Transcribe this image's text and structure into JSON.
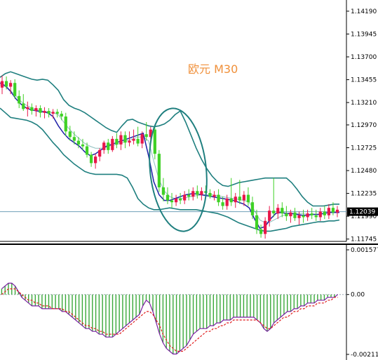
{
  "chart_data": [
    {
      "type": "candlestick",
      "title": "欧元 M30",
      "price_axis_ticks": [
        "1.14190",
        "1.13945",
        "1.13700",
        "1.13455",
        "1.13210",
        "1.12970",
        "1.12725",
        "1.12480",
        "1.12235",
        "1.11990",
        "1.11745"
      ],
      "current_price": "1.12039",
      "ylim": [
        1.1172,
        1.1431
      ],
      "indicators": [
        "Bollinger Bands (upper/middle/lower)",
        "Moving average (blue)",
        "Price path sketch (hand-drawn ellipse annotations)"
      ],
      "colors": {
        "up": "#e8174a",
        "down": "#3fd126",
        "bands": "#1f7f7f",
        "ma": "#1f20a8",
        "price_line": "#6f9fb8",
        "annotation": "#1f7f7f"
      },
      "candles": [
        [
          1.1337,
          1.135,
          1.133,
          1.1344
        ],
        [
          1.1344,
          1.1349,
          1.1335,
          1.1338
        ],
        [
          1.1338,
          1.1345,
          1.133,
          1.1342
        ],
        [
          1.1342,
          1.1346,
          1.1325,
          1.1328
        ],
        [
          1.1328,
          1.1334,
          1.1315,
          1.132
        ],
        [
          1.132,
          1.133,
          1.1312,
          1.1314
        ],
        [
          1.1314,
          1.1322,
          1.1306,
          1.1316
        ],
        [
          1.1316,
          1.132,
          1.1308,
          1.1312
        ],
        [
          1.1312,
          1.1318,
          1.1306,
          1.1315
        ],
        [
          1.1315,
          1.1318,
          1.1305,
          1.131
        ],
        [
          1.131,
          1.1316,
          1.1304,
          1.1312
        ],
        [
          1.1312,
          1.1315,
          1.1305,
          1.1309
        ],
        [
          1.1309,
          1.1314,
          1.1304,
          1.1311
        ],
        [
          1.1311,
          1.1314,
          1.1305,
          1.1309
        ],
        [
          1.1309,
          1.1312,
          1.1302,
          1.1306
        ],
        [
          1.1306,
          1.131,
          1.1285,
          1.129
        ],
        [
          1.129,
          1.1296,
          1.128,
          1.1284
        ],
        [
          1.1284,
          1.129,
          1.1276,
          1.128
        ],
        [
          1.128,
          1.1284,
          1.1272,
          1.1276
        ],
        [
          1.1276,
          1.1282,
          1.127,
          1.1274
        ],
        [
          1.1274,
          1.1278,
          1.1262,
          1.1265
        ],
        [
          1.1265,
          1.1268,
          1.1252,
          1.1256
        ],
        [
          1.1256,
          1.1266,
          1.125,
          1.1263
        ],
        [
          1.1263,
          1.1272,
          1.1258,
          1.127
        ],
        [
          1.127,
          1.128,
          1.1266,
          1.1278
        ],
        [
          1.1278,
          1.1282,
          1.1266,
          1.127
        ],
        [
          1.127,
          1.1285,
          1.1268,
          1.1282
        ],
        [
          1.1282,
          1.1288,
          1.1272,
          1.1276
        ],
        [
          1.1276,
          1.129,
          1.127,
          1.1286
        ],
        [
          1.1286,
          1.129,
          1.1272,
          1.1278
        ],
        [
          1.1278,
          1.129,
          1.1274,
          1.128
        ],
        [
          1.128,
          1.1292,
          1.1276,
          1.1282
        ],
        [
          1.1282,
          1.1295,
          1.1274,
          1.1277
        ],
        [
          1.1277,
          1.129,
          1.1272,
          1.1287
        ],
        [
          1.1287,
          1.13,
          1.128,
          1.1284
        ],
        [
          1.1284,
          1.1295,
          1.1278,
          1.1292
        ],
        [
          1.1292,
          1.1296,
          1.126,
          1.1266
        ],
        [
          1.1266,
          1.127,
          1.1225,
          1.123
        ],
        [
          1.123,
          1.124,
          1.1215,
          1.1222
        ],
        [
          1.1222,
          1.123,
          1.1212,
          1.1216
        ],
        [
          1.1216,
          1.1224,
          1.1208,
          1.1214
        ],
        [
          1.1214,
          1.1222,
          1.121,
          1.1218
        ],
        [
          1.1218,
          1.1224,
          1.1212,
          1.1216
        ],
        [
          1.1216,
          1.1226,
          1.1212,
          1.1222
        ],
        [
          1.1222,
          1.1228,
          1.1216,
          1.122
        ],
        [
          1.122,
          1.123,
          1.1216,
          1.1226
        ],
        [
          1.1226,
          1.1232,
          1.1218,
          1.1222
        ],
        [
          1.1222,
          1.123,
          1.1216,
          1.1226
        ],
        [
          1.1226,
          1.1232,
          1.122,
          1.1224
        ],
        [
          1.1224,
          1.1228,
          1.1218,
          1.122
        ],
        [
          1.122,
          1.1226,
          1.1216,
          1.1222
        ],
        [
          1.1222,
          1.1228,
          1.121,
          1.1214
        ],
        [
          1.1214,
          1.122,
          1.1206,
          1.121
        ],
        [
          1.121,
          1.1222,
          1.1206,
          1.1218
        ],
        [
          1.1218,
          1.124,
          1.121,
          1.1214
        ],
        [
          1.1214,
          1.1224,
          1.1208,
          1.122
        ],
        [
          1.122,
          1.1238,
          1.1212,
          1.1216
        ],
        [
          1.1216,
          1.1226,
          1.121,
          1.1222
        ],
        [
          1.1222,
          1.123,
          1.121,
          1.1214
        ],
        [
          1.1214,
          1.122,
          1.1196,
          1.12
        ],
        [
          1.12,
          1.1206,
          1.118,
          1.1185
        ],
        [
          1.1185,
          1.119,
          1.1176,
          1.118
        ],
        [
          1.118,
          1.1198,
          1.1175,
          1.1194
        ],
        [
          1.1194,
          1.121,
          1.1188,
          1.1205
        ],
        [
          1.1205,
          1.124,
          1.1198,
          1.1202
        ],
        [
          1.1202,
          1.1212,
          1.1196,
          1.1208
        ],
        [
          1.1208,
          1.1214,
          1.1198,
          1.1202
        ],
        [
          1.1202,
          1.121,
          1.1194,
          1.1199
        ],
        [
          1.1199,
          1.1206,
          1.1192,
          1.1203
        ],
        [
          1.1203,
          1.1208,
          1.1194,
          1.1197
        ],
        [
          1.1197,
          1.1204,
          1.119,
          1.12
        ],
        [
          1.12,
          1.1206,
          1.1192,
          1.1198
        ],
        [
          1.1198,
          1.1206,
          1.1194,
          1.1202
        ],
        [
          1.1202,
          1.1208,
          1.1196,
          1.12
        ],
        [
          1.12,
          1.1206,
          1.1194,
          1.1198
        ],
        [
          1.1198,
          1.1208,
          1.1194,
          1.1204
        ],
        [
          1.1204,
          1.121,
          1.1196,
          1.12
        ],
        [
          1.12,
          1.1212,
          1.1196,
          1.1208
        ],
        [
          1.1208,
          1.1214,
          1.12,
          1.1203
        ],
        [
          1.1203,
          1.121,
          1.1198,
          1.1206
        ]
      ],
      "upper_band": [
        1.1348,
        1.1352,
        1.1354,
        1.1352,
        1.135,
        1.1348,
        1.1346,
        1.1345,
        1.1346,
        1.1345,
        1.134,
        1.1334,
        1.1324,
        1.1318,
        1.1315,
        1.1313,
        1.131,
        1.1306,
        1.1302,
        1.1298,
        1.1294,
        1.1291,
        1.1289,
        1.1296,
        1.1302,
        1.1303,
        1.13,
        1.1298,
        1.1296,
        1.1295,
        1.1296,
        1.1298,
        1.1302,
        1.1308,
        1.1312,
        1.13,
        1.1286,
        1.1272,
        1.126,
        1.125,
        1.1242,
        1.1236,
        1.1232,
        1.1231,
        1.1233,
        1.1235,
        1.1236,
        1.1237,
        1.1238,
        1.1239,
        1.124,
        1.124,
        1.124,
        1.124,
        1.124,
        1.1235,
        1.1228,
        1.122,
        1.1214,
        1.121,
        1.121,
        1.121,
        1.1211,
        1.1212,
        1.1212
      ],
      "lower_band": [
        1.1315,
        1.131,
        1.1305,
        1.1304,
        1.1303,
        1.1302,
        1.13,
        1.1297,
        1.1292,
        1.1285,
        1.1278,
        1.1272,
        1.1265,
        1.126,
        1.1255,
        1.1251,
        1.1247,
        1.1245,
        1.1244,
        1.1244,
        1.1244,
        1.1244,
        1.1244,
        1.1243,
        1.124,
        1.123,
        1.1218,
        1.1212,
        1.1208,
        1.1206,
        1.1206,
        1.1207,
        1.1208,
        1.1207,
        1.1206,
        1.1206,
        1.1206,
        1.1206,
        1.1205,
        1.1204,
        1.1203,
        1.1202,
        1.12,
        1.1198,
        1.1195,
        1.1192,
        1.119,
        1.1188,
        1.1186,
        1.1184,
        1.1183,
        1.1183,
        1.1184,
        1.1185,
        1.1186,
        1.1188,
        1.1189,
        1.119,
        1.1191,
        1.1192,
        1.1193,
        1.1193,
        1.1194,
        1.1194,
        1.1195
      ],
      "middle_band": [
        1.134,
        1.1338,
        1.1334,
        1.1328,
        1.1322,
        1.1318,
        1.1315,
        1.1313,
        1.1312,
        1.1311,
        1.131,
        1.1308,
        1.13,
        1.1293,
        1.1287,
        1.1282,
        1.1277,
        1.1274,
        1.1272,
        1.1272,
        1.1273,
        1.1275,
        1.1276,
        1.1278,
        1.128,
        1.1282,
        1.1284,
        1.1284,
        1.128,
        1.1258,
        1.1238,
        1.1226,
        1.122,
        1.1218,
        1.1218,
        1.1219,
        1.122,
        1.1221,
        1.1222,
        1.1222,
        1.1222,
        1.1221,
        1.122,
        1.1219,
        1.1218,
        1.1217,
        1.1216,
        1.1214,
        1.1205,
        1.1195,
        1.1192,
        1.1193,
        1.1196,
        1.1199,
        1.1201,
        1.1202,
        1.1202,
        1.1202,
        1.1201,
        1.1201,
        1.1201,
        1.1202,
        1.1203,
        1.1203,
        1.1203
      ],
      "ma": [
        1.1342,
        1.1339,
        1.1333,
        1.1325,
        1.1319,
        1.1315,
        1.1313,
        1.1312,
        1.1311,
        1.131,
        1.1306,
        1.1296,
        1.1288,
        1.1282,
        1.1278,
        1.1274,
        1.1268,
        1.1264,
        1.1266,
        1.127,
        1.1274,
        1.1276,
        1.1278,
        1.128,
        1.1282,
        1.1284,
        1.1286,
        1.1288,
        1.1264,
        1.1236,
        1.1222,
        1.1216,
        1.1216,
        1.1218,
        1.122,
        1.1222,
        1.1223,
        1.1223,
        1.1222,
        1.1221,
        1.122,
        1.1219,
        1.1218,
        1.1217,
        1.1216,
        1.1214,
        1.1212,
        1.1208,
        1.1196,
        1.1186,
        1.1188,
        1.1196,
        1.1202,
        1.1203,
        1.1202,
        1.1202,
        1.1201,
        1.12,
        1.12,
        1.1201,
        1.1201,
        1.1202,
        1.1203,
        1.1203,
        1.1203
      ]
    },
    {
      "type": "bar",
      "title": "",
      "axis_ticks": [
        "0.001577",
        "0.00",
        "-0.002112"
      ],
      "ylim": [
        -0.002112,
        0.001577
      ],
      "colors": {
        "bars": "#3aa83a",
        "signal": "#e01b1b",
        "line": "#7a1fa2",
        "zero": "#9aa9b3"
      },
      "values": [
        0.0002,
        0.0003,
        0.0004,
        0.0004,
        0.0003,
        0.0001,
        -0.0001,
        -0.0002,
        -0.0003,
        -0.0004,
        -0.0004,
        -0.0004,
        -0.0005,
        -0.0005,
        -0.0005,
        -0.0005,
        -0.0005,
        -0.0005,
        -0.0006,
        -0.0006,
        -0.0007,
        -0.0008,
        -0.0009,
        -0.001,
        -0.0011,
        -0.0012,
        -0.0012,
        -0.0013,
        -0.0013,
        -0.0014,
        -0.0014,
        -0.0015,
        -0.0015,
        -0.0015,
        -0.0014,
        -0.0013,
        -0.0012,
        -0.0011,
        -0.001,
        -0.0009,
        -0.0008,
        -0.0007,
        -0.0004,
        -0.0002,
        -0.0003,
        -0.0006,
        -0.001,
        -0.0014,
        -0.0017,
        -0.0019,
        -0.002,
        -0.0021,
        -0.0021,
        -0.002,
        -0.0019,
        -0.0018,
        -0.0016,
        -0.0014,
        -0.0013,
        -0.0012,
        -0.0012,
        -0.0012,
        -0.0011,
        -0.0011,
        -0.001,
        -0.001,
        -0.0009,
        -0.0009,
        -0.0009,
        -0.0008,
        -0.0008,
        -0.0008,
        -0.0008,
        -0.0008,
        -0.0008,
        -0.0008,
        -0.0009,
        -0.001,
        -0.0012,
        -0.0013,
        -0.0012,
        -0.001,
        -0.0009,
        -0.0008,
        -0.0007,
        -0.0006,
        -0.0006,
        -0.0005,
        -0.0005,
        -0.0004,
        -0.0004,
        -0.0003,
        -0.0003,
        -0.0003,
        -0.0002,
        -0.0002,
        -0.0002,
        -0.0001,
        -0.0001,
        -0.0001,
        0.0
      ],
      "signal": [
        0.0,
        0.0001,
        0.0002,
        0.0002,
        0.0002,
        0.0001,
        0.0,
        -0.0001,
        -0.0002,
        -0.0002,
        -0.0003,
        -0.0003,
        -0.0004,
        -0.0004,
        -0.0004,
        -0.0005,
        -0.0005,
        -0.0005,
        -0.0005,
        -0.0006,
        -0.0006,
        -0.0007,
        -0.0008,
        -0.0009,
        -0.001,
        -0.0011,
        -0.0011,
        -0.0012,
        -0.0012,
        -0.0013,
        -0.0013,
        -0.0014,
        -0.0014,
        -0.0014,
        -0.0014,
        -0.0014,
        -0.0013,
        -0.0012,
        -0.0011,
        -0.001,
        -0.0009,
        -0.0008,
        -0.0007,
        -0.0006,
        -0.0006,
        -0.0007,
        -0.0009,
        -0.0011,
        -0.0014,
        -0.0016,
        -0.0018,
        -0.0019,
        -0.002,
        -0.002,
        -0.002,
        -0.0019,
        -0.0018,
        -0.0017,
        -0.0016,
        -0.0015,
        -0.0014,
        -0.0013,
        -0.0013,
        -0.0012,
        -0.0012,
        -0.0011,
        -0.0011,
        -0.001,
        -0.001,
        -0.0009,
        -0.0009,
        -0.0009,
        -0.0009,
        -0.0009,
        -0.0009,
        -0.0009,
        -0.0009,
        -0.001,
        -0.0011,
        -0.0012,
        -0.0012,
        -0.0011,
        -0.001,
        -0.0009,
        -0.0008,
        -0.0008,
        -0.0007,
        -0.0006,
        -0.0006,
        -0.0005,
        -0.0005,
        -0.0004,
        -0.0004,
        -0.0004,
        -0.0003,
        -0.0003,
        -0.0003,
        -0.0002,
        -0.0002,
        -0.0001,
        -0.0001
      ]
    }
  ]
}
